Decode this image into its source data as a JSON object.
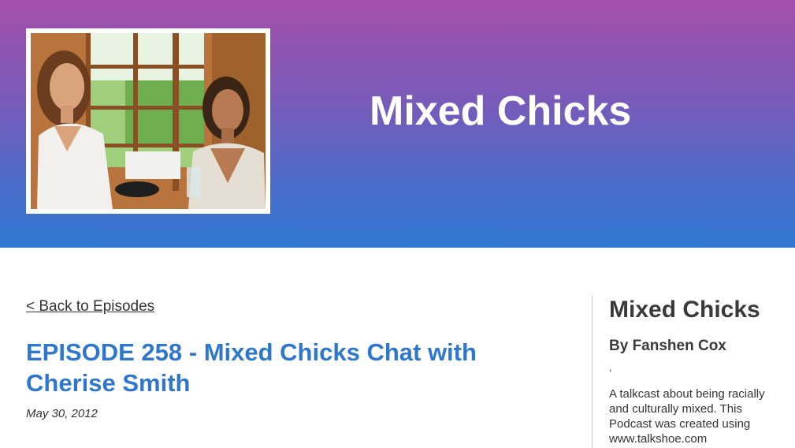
{
  "header": {
    "site_title": "Mixed Chicks"
  },
  "nav": {
    "back_label": "< Back to Episodes"
  },
  "episode": {
    "title": "EPISODE 258 - Mixed Chicks Chat with Cherise Smith",
    "date": "May 30, 2012"
  },
  "sidebar": {
    "title": "Mixed Chicks",
    "author": "By Fanshen Cox",
    "separator": ",",
    "description": "A talkcast about being racially and culturally mixed. This Podcast was created using www.talkshoe.com"
  },
  "colors": {
    "header_top": "#a34fa9",
    "header_bottom": "#2f78d3",
    "episode_title": "#2f77cc"
  }
}
